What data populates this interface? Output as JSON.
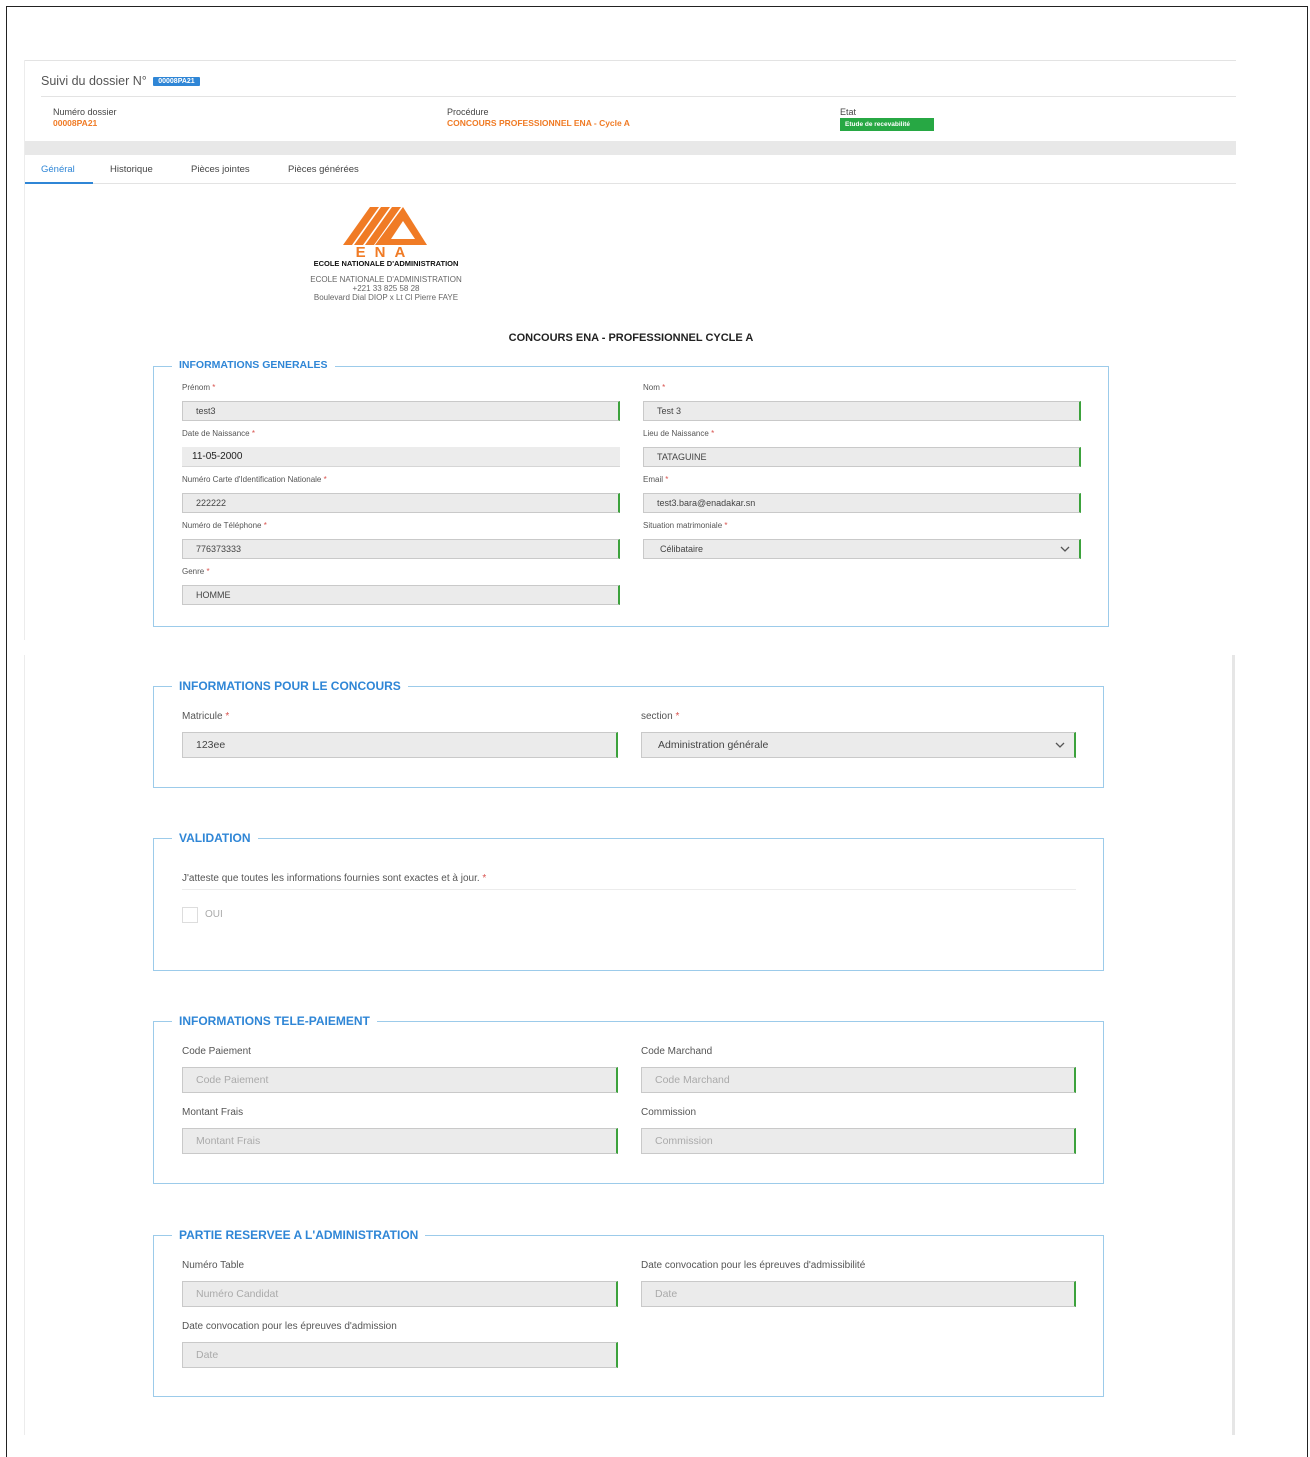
{
  "header": {
    "title": "Suivi du dossier N°",
    "badge": "00008PA21",
    "dossier_label": "Numéro dossier",
    "dossier_value": "00008PA21",
    "procedure_label": "Procédure",
    "procedure_value": "CONCOURS PROFESSIONNEL ENA - Cycle A",
    "etat_label": "Etat",
    "etat_value": "Etude de recevabilité"
  },
  "tabs": [
    "Général",
    "Historique",
    "Pièces jointes",
    "Pièces générées"
  ],
  "logo": {
    "letters": "ENA",
    "caption": "ECOLE NATIONALE D'ADMINISTRATION",
    "line1": "ECOLE NATIONALE D'ADMINISTRATION",
    "line2": "+221 33 825 58 28",
    "line3": "Boulevard Dial DIOP x Lt Cl Pierre FAYE"
  },
  "document_title": "CONCOURS ENA - PROFESSIONNEL CYCLE A",
  "info_generales": {
    "legend": "INFORMATIONS GENERALES",
    "prenom_label": "Prénom",
    "prenom_value": "test3",
    "nom_label": "Nom",
    "nom_value": "Test 3",
    "date_naissance_label": "Date de Naissance",
    "date_naissance_value": "11-05-2000",
    "lieu_naissance_label": "Lieu de Naissance",
    "lieu_naissance_value": "TATAGUINE",
    "cni_label": "Numéro Carte d'Identification Nationale",
    "cni_value": "222222",
    "email_label": "Email",
    "email_value": "test3.bara@enadakar.sn",
    "telephone_label": "Numéro de Téléphone",
    "telephone_value": "776373333",
    "situation_label": "Situation matrimoniale",
    "situation_value": "Célibataire",
    "genre_label": "Genre",
    "genre_value": "HOMME"
  },
  "info_concours": {
    "legend": "INFORMATIONS POUR LE CONCOURS",
    "matricule_label": "Matricule",
    "matricule_value": "123ee",
    "section_label": "section",
    "section_value": "Administration générale"
  },
  "validation": {
    "legend": "VALIDATION",
    "statement": "J'atteste que toutes les informations fournies sont exactes et à jour.",
    "option": "OUI"
  },
  "telepaiement": {
    "legend": "INFORMATIONS TELE-PAIEMENT",
    "code_paiement_label": "Code Paiement",
    "code_paiement_placeholder": "Code Paiement",
    "code_marchand_label": "Code Marchand",
    "code_marchand_placeholder": "Code Marchand",
    "montant_label": "Montant Frais",
    "montant_placeholder": "Montant Frais",
    "commission_label": "Commission",
    "commission_placeholder": "Commission"
  },
  "administration": {
    "legend": "PARTIE RESERVEE A L'ADMINISTRATION",
    "numero_table_label": "Numéro Table",
    "numero_table_placeholder": "Numéro Candidat",
    "date_admissibilite_label": "Date convocation pour les épreuves d'admissibilité",
    "date_admissibilite_placeholder": "Date",
    "date_admission_label": "Date convocation pour les épreuves d'admission",
    "date_admission_placeholder": "Date"
  },
  "required_mark": "*",
  "colors": {
    "accent": "#2f86d6",
    "orange": "#f07b25",
    "success": "#27a844",
    "valid_border": "#3ca23c"
  }
}
